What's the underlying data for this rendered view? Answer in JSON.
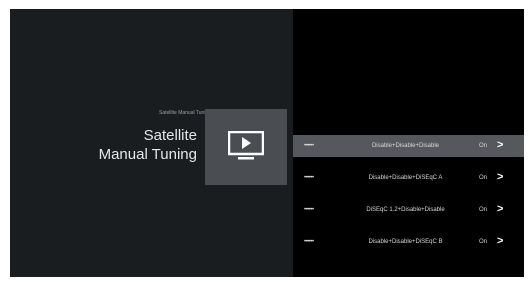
{
  "header": {
    "breadcrumb": "Satellite Manual Tuning",
    "title_line1": "Satellite",
    "title_line2": "Manual Tuning"
  },
  "tile": {
    "icon": "tv-play-icon"
  },
  "colors": {
    "background": "#000000",
    "left_pane": "#1a1d20",
    "selected_row": "#55595d",
    "tile": "#4a4e52"
  },
  "list": {
    "rows": [
      {
        "stars": "••••••",
        "desc": "Disable+Disable+Disable",
        "state": "On",
        "chevron": ">"
      },
      {
        "stars": "••••••",
        "desc": "Disable+Disable+DiSEqC A",
        "state": "On",
        "chevron": ">"
      },
      {
        "stars": "••••••",
        "desc": "DiSEqC 1.2+Disable+Disable",
        "state": "On",
        "chevron": ">"
      },
      {
        "stars": "••••••",
        "desc": "Disable+Disable+DiSEqC B",
        "state": "On",
        "chevron": ">"
      }
    ]
  }
}
